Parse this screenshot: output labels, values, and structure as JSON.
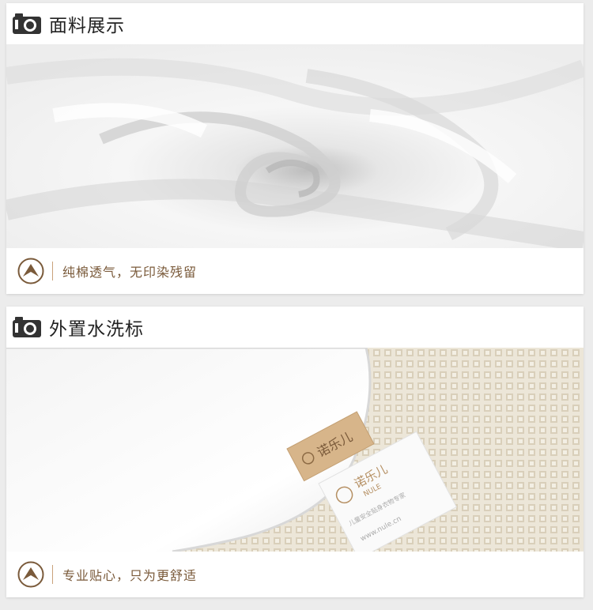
{
  "sections": [
    {
      "title": "面料展示",
      "caption": "纯棉透气，无印染残留"
    },
    {
      "title": "外置水洗标",
      "caption": "专业贴心，只为更舒适"
    }
  ],
  "label": {
    "brand_cn": "诺乐儿",
    "brand_en": "NULE",
    "tagline": "儿童安全贴身衣物专家",
    "url": "www.nule.cn"
  },
  "colors": {
    "accent": "#7a5a3a",
    "label_tan": "#d7b58a"
  },
  "icons": {
    "header": "camera-icon",
    "footer": "brand-logo-icon"
  }
}
